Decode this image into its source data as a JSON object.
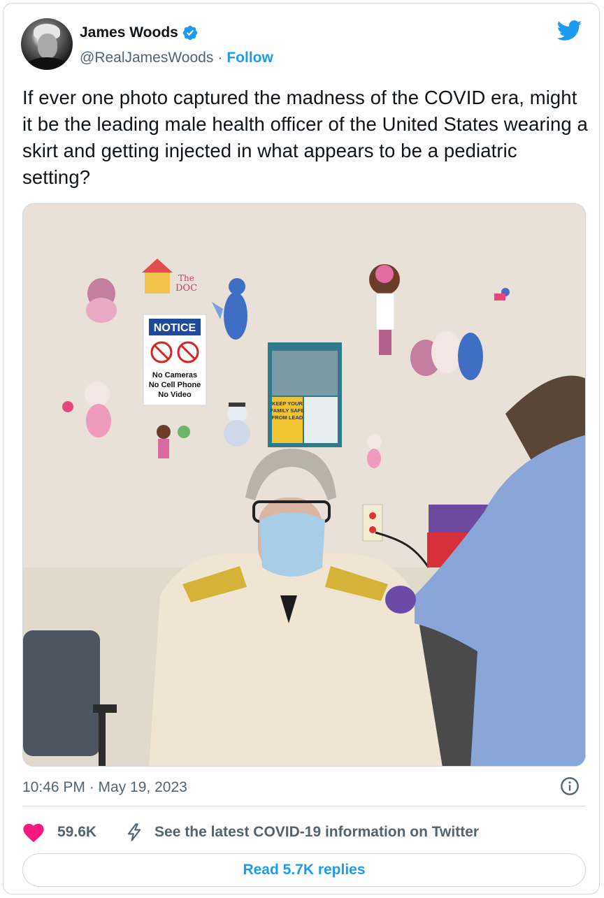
{
  "author": {
    "display_name": "James Woods",
    "handle": "@RealJamesWoods",
    "separator": "·",
    "follow_label": "Follow",
    "verified": true
  },
  "tweet": {
    "text": "If ever one photo captured the madness of the COVID era, might it be the leading male health officer of the United States wearing a skirt and getting injected in what appears to be a pediatric setting?"
  },
  "photo": {
    "notice_sign": {
      "title": "NOTICE",
      "lines": [
        "No Cameras",
        "No Cell Phone",
        "No Video"
      ]
    },
    "poster_lines": [
      "KEEP YOUR",
      "FAMILY SAFE",
      "FROM LEAD"
    ]
  },
  "footer": {
    "timestamp": "10:46 PM · May 19, 2023",
    "like_count": "59.6K",
    "covid_info_label": "See the latest COVID-19 information on Twitter",
    "replies_label": "Read 5.7K replies"
  },
  "colors": {
    "brand_blue": "#1d9bf0",
    "like_pink": "#f91880",
    "secondary_text": "#536471",
    "border": "#cfd9de"
  },
  "icons": {
    "verified": "verified-badge-icon",
    "brand": "twitter-bird-icon",
    "info": "info-icon",
    "like": "heart-icon",
    "covid": "lightning-icon"
  }
}
